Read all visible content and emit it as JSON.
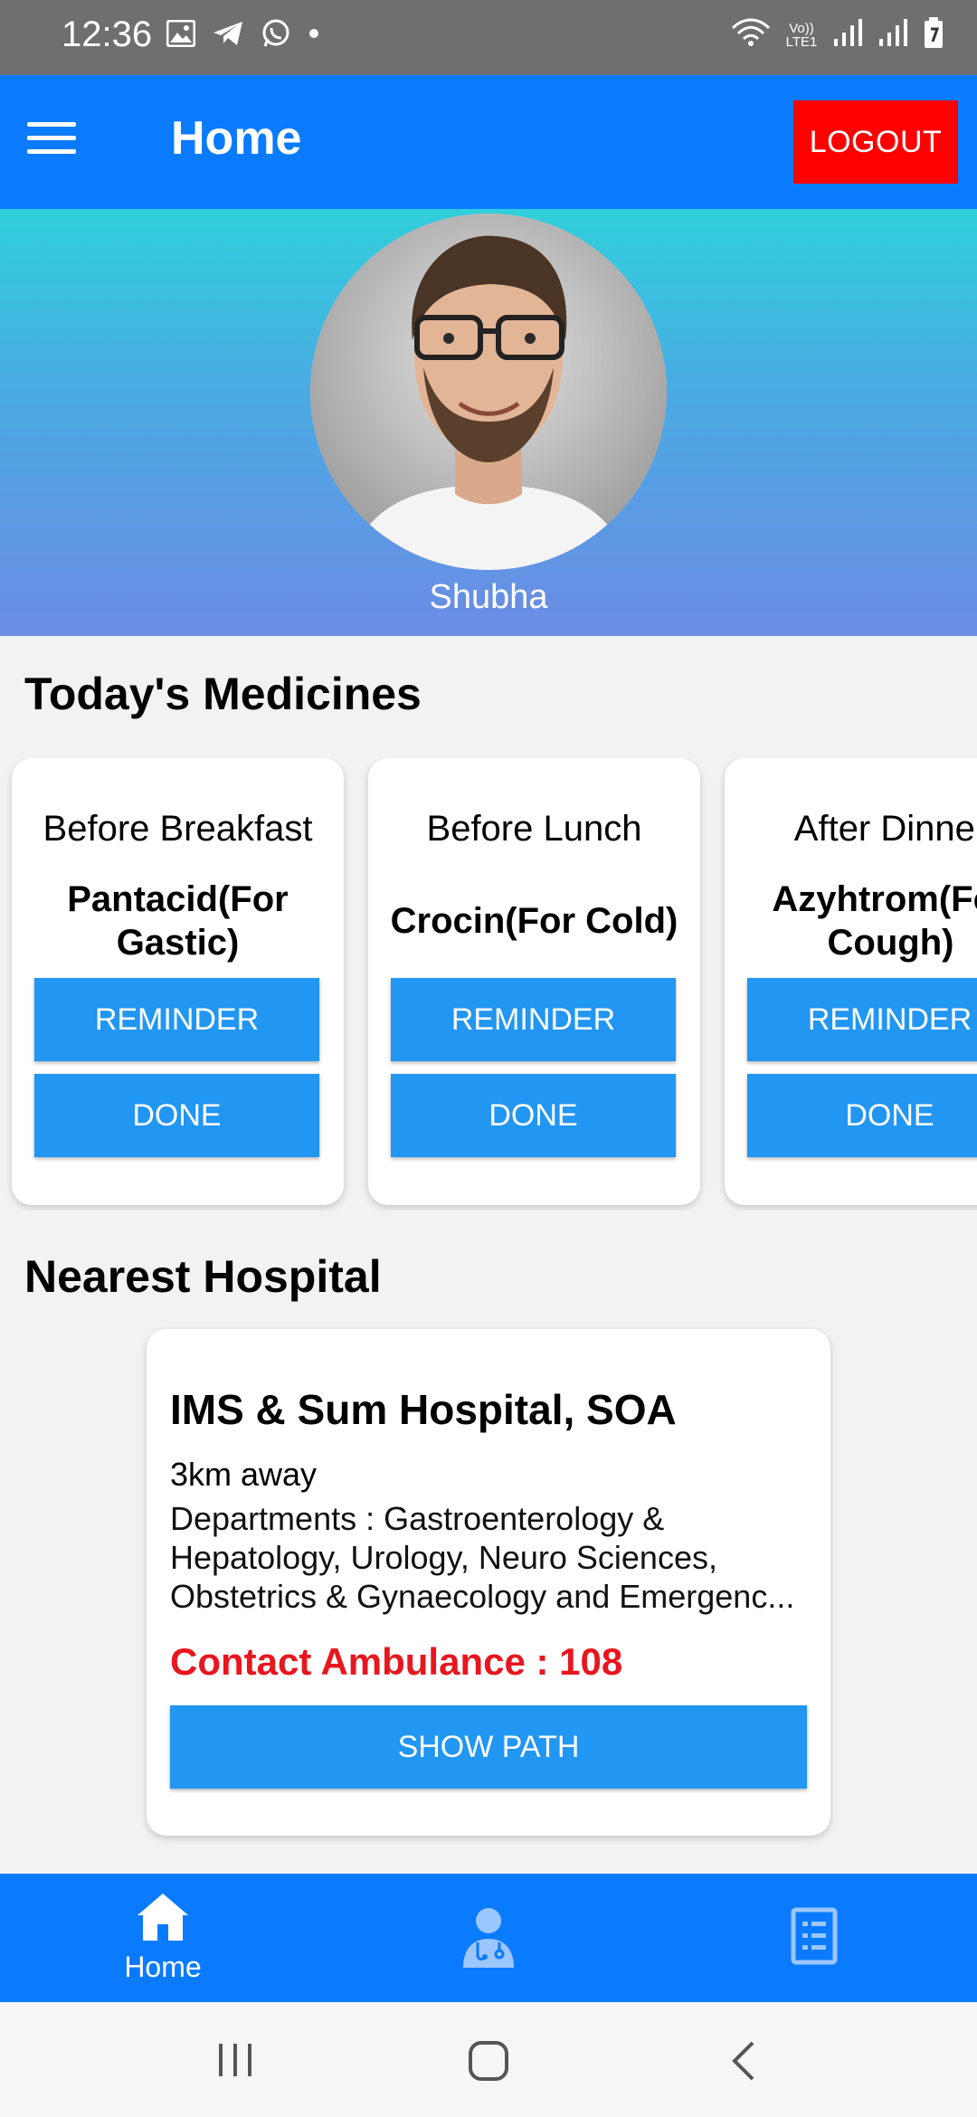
{
  "status_bar": {
    "time": "12:36",
    "left_icons": [
      "gallery-icon",
      "telegram-icon",
      "whatsapp-icon",
      "dot-icon"
    ],
    "right_icons": [
      "wifi-icon",
      "volte-icon",
      "signal-icon",
      "signal-icon-2",
      "battery-icon"
    ],
    "volte_label": "Vo)) LTE1"
  },
  "app_bar": {
    "title": "Home",
    "logout_label": "LOGOUT"
  },
  "profile": {
    "name": "Shubha"
  },
  "medicines": {
    "section_title": "Today's Medicines",
    "cards": [
      {
        "time": "Before Breakfast",
        "name": "Pantacid(For Gastic)",
        "reminder_label": "REMINDER",
        "done_label": "DONE"
      },
      {
        "time": "Before Lunch",
        "name": "Crocin(For Cold)",
        "reminder_label": "REMINDER",
        "done_label": "DONE"
      },
      {
        "time": "After Dinner",
        "name": "Azyhtrom(For Cough)",
        "reminder_label": "REMINDER",
        "done_label": "DONE"
      }
    ]
  },
  "hospital": {
    "section_title": "Nearest Hospital",
    "name": "IMS & Sum Hospital, SOA",
    "distance": "3km away",
    "departments": "Departments : Gastroenterology & Hepatology, Urology, Neuro Sciences, Obstetrics & Gynaecology and Emergenc...",
    "contact": "Contact Ambulance : 108",
    "show_path_label": "SHOW PATH"
  },
  "bottom_nav": {
    "items": [
      {
        "label": "Home",
        "icon": "home-icon",
        "active": true
      },
      {
        "label": "",
        "icon": "doctor-icon",
        "active": false
      },
      {
        "label": "",
        "icon": "document-icon",
        "active": false
      }
    ]
  },
  "colors": {
    "app_bar": "#0a7bff",
    "logout": "#ff0000",
    "button": "#2196f3",
    "contact_text": "#e8161e"
  }
}
